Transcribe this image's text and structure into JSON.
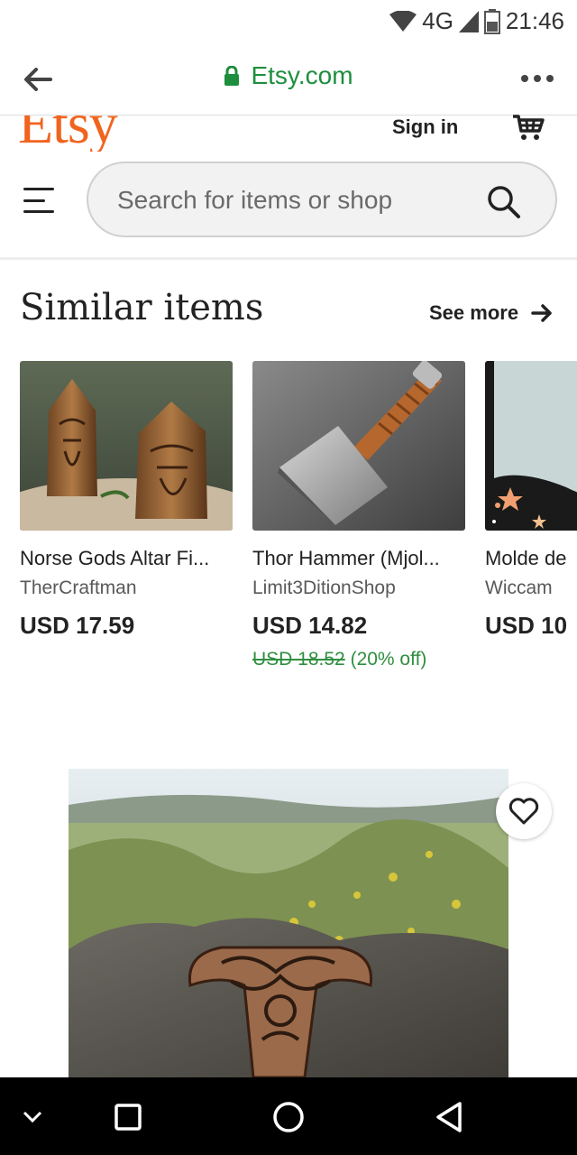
{
  "status_bar": {
    "network": "4G",
    "time": "21:46"
  },
  "browser": {
    "url": "Etsy.com",
    "icons": [
      "back-arrow-icon",
      "lock-icon",
      "more-options-icon"
    ]
  },
  "header": {
    "logo": "Etsy",
    "sign_in": "Sign in",
    "search_placeholder": "Search for items or shop"
  },
  "similar": {
    "title": "Similar items",
    "see_more": "See more",
    "items": [
      {
        "title": "Norse Gods Altar Fi...",
        "shop": "TherCraftman",
        "price": "USD 17.59",
        "original_price": "",
        "discount": ""
      },
      {
        "title": "Thor Hammer (Mjol...",
        "shop": "Limit3DitionShop",
        "price": "USD 14.82",
        "original_price": "USD 18.52",
        "discount": "(20% off)"
      },
      {
        "title": "Molde de",
        "shop": "Wiccam",
        "price": "USD 10",
        "original_price": "",
        "discount": ""
      }
    ]
  },
  "colors": {
    "brand": "#f1641e",
    "secure_green": "#1e8e3e",
    "discount_green": "#2f8f3f"
  }
}
